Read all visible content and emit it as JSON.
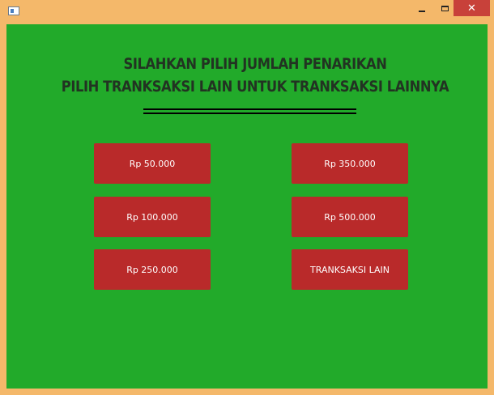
{
  "window": {
    "controls": {
      "minimize": "minimize",
      "maximize": "maximize",
      "close": "✕"
    }
  },
  "heading": {
    "line1": "SILAHKAN PILIH JUMLAH PENARIKAN",
    "line2": "PILIH TRANKSAKSI LAIN UNTUK TRANKSAKSI LAINNYA"
  },
  "buttons": {
    "amount_50000": "Rp 50.000",
    "amount_350000": "Rp 350.000",
    "amount_100000": "Rp 100.000",
    "amount_500000": "Rp 500.000",
    "amount_250000": "Rp 250.000",
    "other_transaction": "TRANKSAKSI LAIN"
  },
  "colors": {
    "frame": "#f4b86a",
    "background": "#22aa2a",
    "button": "#b92a2a",
    "close_button": "#c8413a",
    "heading_text": "#223322"
  }
}
